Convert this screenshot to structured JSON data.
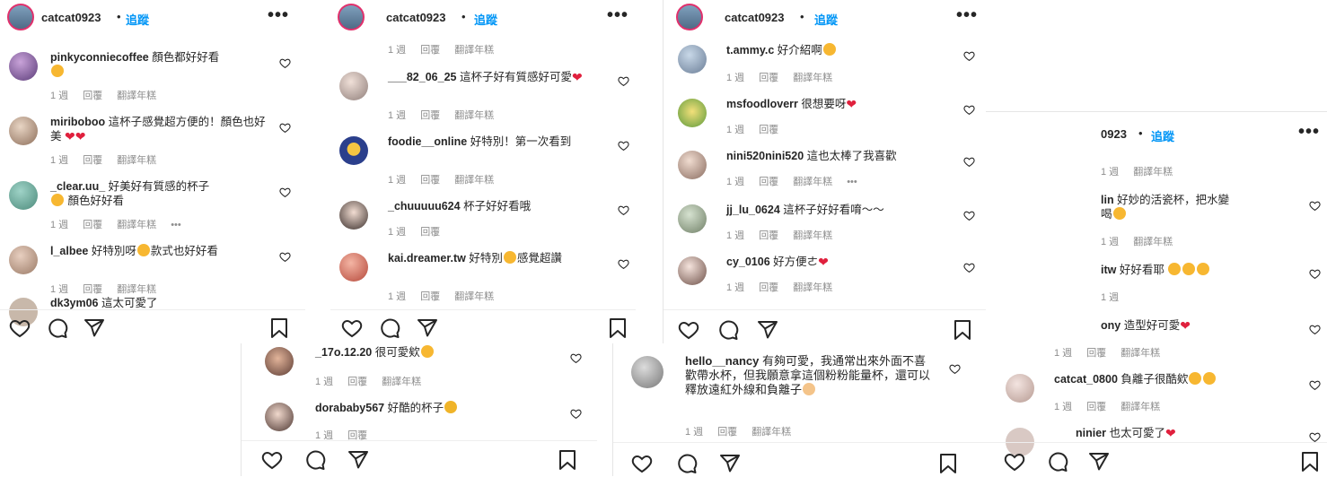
{
  "header": {
    "username": "catcat0923",
    "follow_label": "追蹤",
    "more_label": "•••",
    "separator": "•"
  },
  "header4": {
    "username": "0923"
  },
  "meta": {
    "reply": "回覆",
    "translate": "翻譯年糕"
  },
  "panel1": {
    "comments": [
      {
        "user": "pinkyconniecoffee",
        "text": "顏色都好好看",
        "time": "1 週"
      },
      {
        "user": "miriboboo",
        "text": "這杯子感覺超方便的！顏色也好美",
        "time": "1 週"
      },
      {
        "user": "_clear.uu_",
        "text": "好美好有質感的杯子",
        "text2": "顏色好好看",
        "time": "1 週",
        "extra": "•••"
      },
      {
        "user": "l_albee",
        "text": "好特別呀",
        "text2": "款式也好好看",
        "time": "1 週"
      },
      {
        "user": "dk3ym06",
        "text": "這太可愛了",
        "time": ""
      }
    ]
  },
  "panel2": {
    "top_time": "1 週",
    "comments": [
      {
        "user": "___82_06_25",
        "text": "這杯子好有質感好可愛",
        "time": "1 週"
      },
      {
        "user": "foodie__online",
        "text": "好特別！第一次看到",
        "time": "1 週"
      },
      {
        "user": "_chuuuuu624",
        "text": "杯子好好看哦",
        "time": "1 週"
      },
      {
        "user": "kai.dreamer.tw",
        "text": "好特別",
        "text2": "感覺超讚",
        "time": "1 週"
      }
    ]
  },
  "panel3": {
    "comments": [
      {
        "user": "t.ammy.c",
        "text": "好介紹啊",
        "time": "1 週"
      },
      {
        "user": "msfoodloverr",
        "text": "很想要呀",
        "time": "1 週"
      },
      {
        "user": "nini520nini520",
        "text": "這也太棒了我喜歡",
        "time": "1 週",
        "extra": "•••"
      },
      {
        "user": "jj_lu_0624",
        "text": "這杯子好好看唷～～",
        "time": "1 週"
      },
      {
        "user": "cy_0106",
        "text": "好方便ㄜ",
        "time": "1 週"
      }
    ]
  },
  "panel4": {
    "top_time": "1 週",
    "comments": [
      {
        "user": "lin",
        "text": "好妙的活瓷杯，把水變",
        "text_line2": "喝",
        "time": "1 週"
      },
      {
        "user": "itw",
        "text": "好好看耶",
        "time": "1 週"
      },
      {
        "user": "ony",
        "text": "造型好可愛",
        "time": "1 週"
      },
      {
        "user": "catcat_0800",
        "text": "負離子很酷欸",
        "time": "1 週"
      },
      {
        "user": "ninier",
        "text": "也太可愛了",
        "time": ""
      }
    ]
  },
  "panel5": {
    "comments": [
      {
        "user": "_17o.12.20",
        "text": "很可愛欸",
        "time": "1 週"
      },
      {
        "user": "dorababy567",
        "text": "好酷的杯子",
        "time": "1 週"
      }
    ]
  },
  "panel6": {
    "comments": [
      {
        "user": "hello__nancy",
        "text": "有夠可愛，我通常出來外面不喜歡帶水杯，但我願意拿這個粉粉能量杯，還可以釋放遠紅外線和負離子",
        "time": "1 週"
      }
    ]
  },
  "colors": {
    "accent": "#0095f6",
    "heart": "#e0203d",
    "meta": "#8e8e8e",
    "text": "#262626"
  },
  "icons": [
    "heart-icon",
    "comment-icon",
    "share-icon",
    "bookmark-icon",
    "more-icon"
  ]
}
